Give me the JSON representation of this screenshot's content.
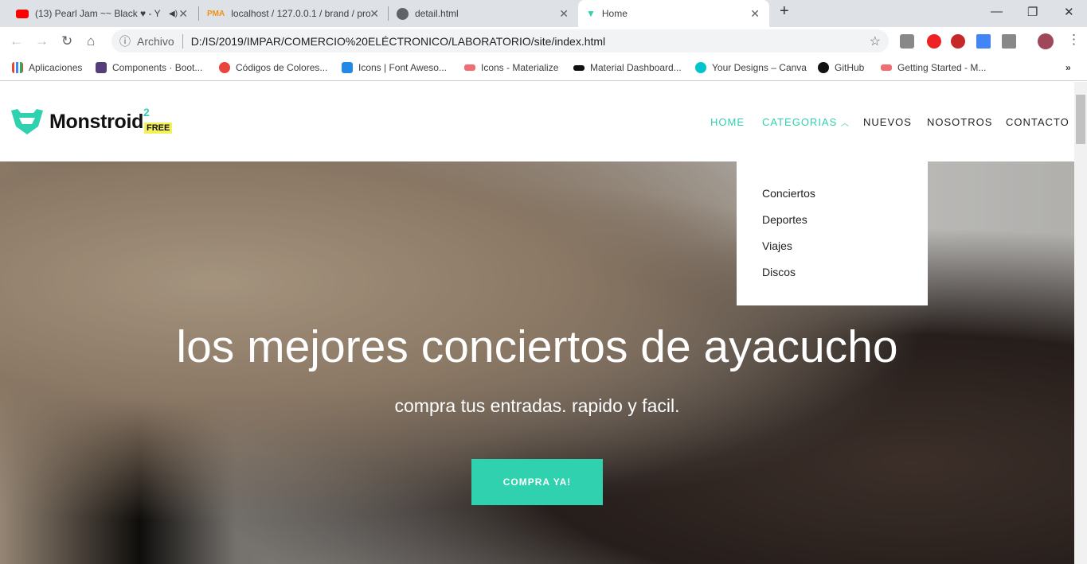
{
  "browser": {
    "tabs": [
      {
        "title": "(13) Pearl Jam ~~ Black ♥ - Y",
        "icon": "youtube-icon"
      },
      {
        "title": "localhost / 127.0.0.1 / brand / pro",
        "icon": "phpmyadmin-icon"
      },
      {
        "title": "detail.html",
        "icon": "globe-icon"
      },
      {
        "title": "Home",
        "icon": "monstroid-icon"
      }
    ],
    "address_label": "Archivo",
    "url": "D:/IS/2019/IMPAR/COMERCIO%20ELÉCTRONICO/LABORATORIO/site/index.html",
    "bookmarks": [
      {
        "label": "Aplicaciones",
        "color": "#4285f4"
      },
      {
        "label": "Components · Boot...",
        "color": "#563d7c"
      },
      {
        "label": "Códigos de Colores...",
        "color": "#e8453c"
      },
      {
        "label": "Icons | Font Aweso...",
        "color": "#228ae6"
      },
      {
        "label": "Icons - Materialize",
        "color": "#ee6e73"
      },
      {
        "label": "Material Dashboard...",
        "color": "#111111"
      },
      {
        "label": "Your Designs – Canva",
        "color": "#00c4cc"
      },
      {
        "label": "GitHub",
        "color": "#111111"
      },
      {
        "label": "Getting Started - M...",
        "color": "#ee6e73"
      }
    ],
    "more": "»"
  },
  "site": {
    "brand": "Monstroid",
    "brand_sup": "2",
    "badge": "FREE",
    "accent": "#2fd1ae",
    "menu": [
      "HOME",
      "CATEGORIAS",
      "NUEVOS",
      "NOSOTROS",
      "CONTACTO"
    ],
    "dropdown": [
      "Conciertos",
      "Deportes",
      "Viajes",
      "Discos"
    ],
    "hero": {
      "title": "los mejores conciertos de ayacucho",
      "subtitle": "compra tus entradas. rapido y facil.",
      "cta": "COMPRA YA!"
    }
  }
}
